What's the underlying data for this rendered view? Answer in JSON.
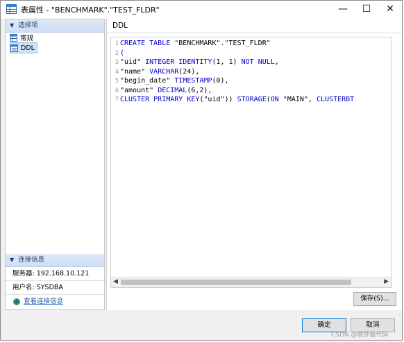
{
  "window": {
    "title": "表属性 - \"BENCHMARK\".\"TEST_FLDR\"",
    "minimize": "—",
    "maximize": "☐",
    "close": "✕"
  },
  "left_panel": {
    "options_header": "选择项",
    "nav_items": [
      {
        "label": "常规",
        "icon": "table-icon"
      },
      {
        "label": "DDL",
        "icon": "ddl-icon"
      }
    ],
    "connection_header": "连接信息",
    "server_label": "服务器: 192.168.10.121",
    "user_label": "用户名: SYSDBA",
    "view_connection_link": "查看连接信息"
  },
  "right_panel": {
    "title": "DDL",
    "save_button": "保存(S)..."
  },
  "editor": {
    "line_numbers": [
      "1",
      "2",
      "3",
      "4",
      "5",
      "6",
      "7"
    ]
  },
  "footer": {
    "ok_button": "确定",
    "cancel_button": "取消"
  },
  "watermark": "CSDN @做梦敲代码",
  "colors": {
    "keyword": "#0000cc",
    "selection": "#cde1f7",
    "accent": "#0078d7"
  }
}
